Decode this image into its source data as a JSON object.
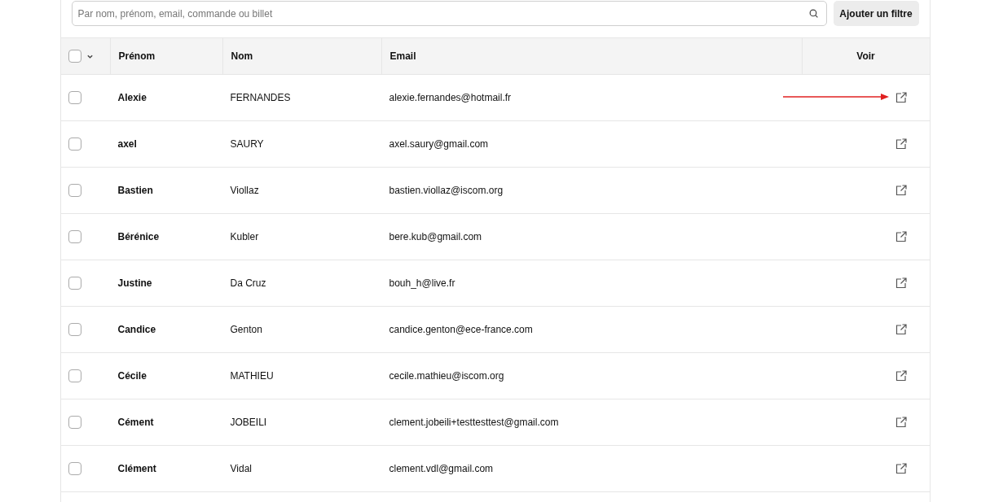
{
  "search": {
    "placeholder": "Par nom, prénom, email, commande ou billet"
  },
  "filter_button": "Ajouter un filtre",
  "table": {
    "select_all": {
      "checked": false
    },
    "columns": [
      "Prénom",
      "Nom",
      "Email",
      "Voir"
    ],
    "rows": [
      {
        "first_name": "Alexie",
        "last_name": "FERNANDES",
        "email": "alexie.fernandes@hotmail.fr",
        "checked": false,
        "arrow": true
      },
      {
        "first_name": "axel",
        "last_name": "SAURY",
        "email": "axel.saury@gmail.com",
        "checked": false,
        "arrow": false
      },
      {
        "first_name": "Bastien",
        "last_name": "Viollaz",
        "email": "bastien.viollaz@iscom.org",
        "checked": false,
        "arrow": false
      },
      {
        "first_name": "Bérénice",
        "last_name": "Kubler",
        "email": "bere.kub@gmail.com",
        "checked": false,
        "arrow": false
      },
      {
        "first_name": "Justine",
        "last_name": "Da Cruz",
        "email": "bouh_h@live.fr",
        "checked": false,
        "arrow": false
      },
      {
        "first_name": "Candice",
        "last_name": "Genton",
        "email": "candice.genton@ece-france.com",
        "checked": false,
        "arrow": false
      },
      {
        "first_name": "Cécile",
        "last_name": "MATHIEU",
        "email": "cecile.mathieu@iscom.org",
        "checked": false,
        "arrow": false
      },
      {
        "first_name": "Cément",
        "last_name": "JOBEILI",
        "email": "clement.jobeili+testtesttest@gmail.com",
        "checked": false,
        "arrow": false
      },
      {
        "first_name": "Clément",
        "last_name": "Vidal",
        "email": "clement.vdl@gmail.com",
        "checked": false,
        "arrow": false
      }
    ]
  }
}
